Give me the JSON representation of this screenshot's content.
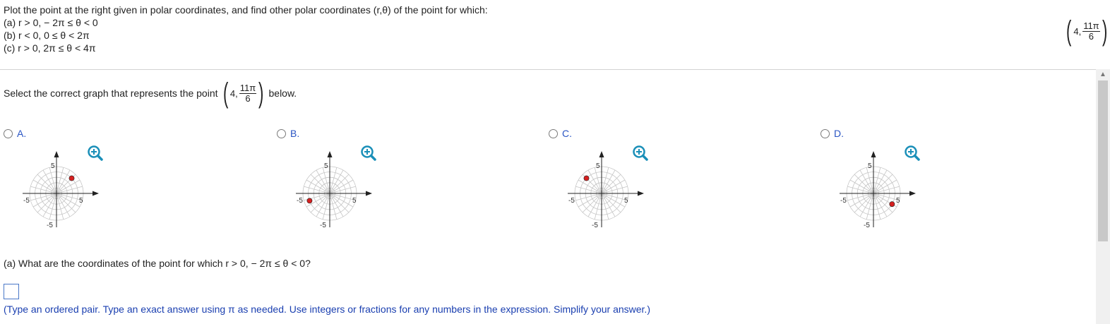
{
  "question": {
    "prompt": "Plot the point at the right given in polar coordinates, and find other polar coordinates (r,θ) of the point for which:",
    "part_a": "(a) r > 0,  − 2π ≤ θ < 0",
    "part_b": "(b) r < 0, 0 ≤ θ < 2π",
    "part_c": "(c) r > 0, 2π ≤ θ < 4π",
    "point": {
      "r": "4",
      "theta_num": "11π",
      "theta_den": "6",
      "sep": ","
    }
  },
  "select": {
    "lead": "Select the correct graph that represents the point",
    "trail": "below."
  },
  "options": [
    {
      "label": "A.",
      "point_r": 4,
      "point_theta_deg": 45
    },
    {
      "label": "B.",
      "point_r": 4,
      "point_theta_deg": 200
    },
    {
      "label": "C.",
      "point_r": 4,
      "point_theta_deg": 135
    },
    {
      "label": "D.",
      "point_r": 4,
      "point_theta_deg": -30
    }
  ],
  "graph": {
    "tick_pos": "5",
    "tick_neg": "-5",
    "max_r": 5,
    "rings": 5,
    "spokes": 24
  },
  "sub_question": "(a) What are the coordinates of the point for which r > 0,  − 2π ≤ θ < 0?",
  "hint": "(Type an ordered pair. Type an exact answer using π as needed. Use integers or fractions for any numbers in the expression. Simplify your answer.)",
  "colors": {
    "point": "#d62020",
    "option_label": "#2a55c4",
    "hint": "#1a3fb0",
    "zoom": "#1a8fb8"
  }
}
